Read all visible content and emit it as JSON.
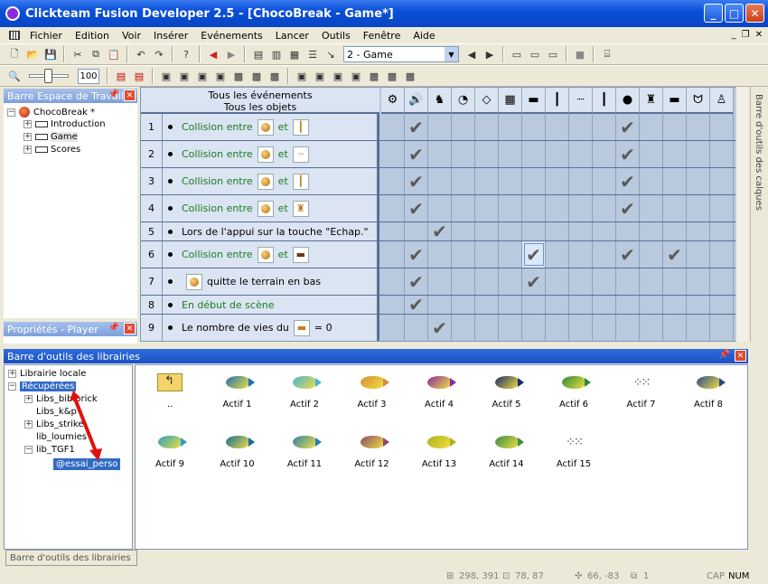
{
  "window": {
    "title": "Clickteam Fusion Developer 2.5 - [ChocoBreak - Game*]"
  },
  "menu": [
    "Fichier",
    "Edition",
    "Voir",
    "Insérer",
    "Evénements",
    "Lancer",
    "Outils",
    "Fenêtre",
    "Aide"
  ],
  "toolbar": {
    "frame_combo": "2 - Game",
    "zoom": "100"
  },
  "workspace": {
    "title": "Barre Espace de Travail",
    "root": "ChocoBreak *",
    "frames": [
      "Introduction",
      "Game",
      "Scores"
    ]
  },
  "properties": {
    "title": "Propriétés - Player"
  },
  "events": {
    "header_line1": "Tous les événements",
    "header_line2": "Tous les objets",
    "rows": [
      {
        "num": "1",
        "parts": [
          "Collision entre",
          "et"
        ]
      },
      {
        "num": "2",
        "parts": [
          "Collision entre",
          "et"
        ]
      },
      {
        "num": "3",
        "parts": [
          "Collision entre",
          "et"
        ]
      },
      {
        "num": "4",
        "parts": [
          "Collision entre",
          "et"
        ]
      },
      {
        "num": "5",
        "parts": [
          "Lors de l'appui sur la touche \"Echap.\""
        ]
      },
      {
        "num": "6",
        "parts": [
          "Collision entre",
          "et"
        ]
      },
      {
        "num": "7",
        "parts": [
          "quitte le terrain en bas"
        ]
      },
      {
        "num": "8",
        "parts": [
          "En début de scène"
        ]
      },
      {
        "num": "9",
        "parts": [
          "Le nombre de vies du",
          "= 0"
        ]
      }
    ]
  },
  "right_tab": "Barre d'outils des calques",
  "library": {
    "title": "Barre d'outils des librairies",
    "tree": [
      "Librairie locale",
      "Récupérées",
      "Libs_bibibrick",
      "Libs_k&p",
      "Libs_strike",
      "lib_loumies",
      "lib_TGF1",
      "@essai_perso"
    ],
    "items": [
      "..",
      "Actif 1",
      "Actif 2",
      "Actif 3",
      "Actif 4",
      "Actif 5",
      "Actif 6",
      "Actif 7",
      "Actif 8",
      "Actif 9",
      "Actif 10",
      "Actif 11",
      "Actif 12",
      "Actif 13",
      "Actif 14",
      "Actif 15"
    ],
    "tab": "Barre d'outils des librairies"
  },
  "status": {
    "coords": "298, 391",
    "size": "78, 87",
    "offset": "66, -83",
    "layer": "1",
    "cap": "CAP",
    "num": "NUM"
  }
}
